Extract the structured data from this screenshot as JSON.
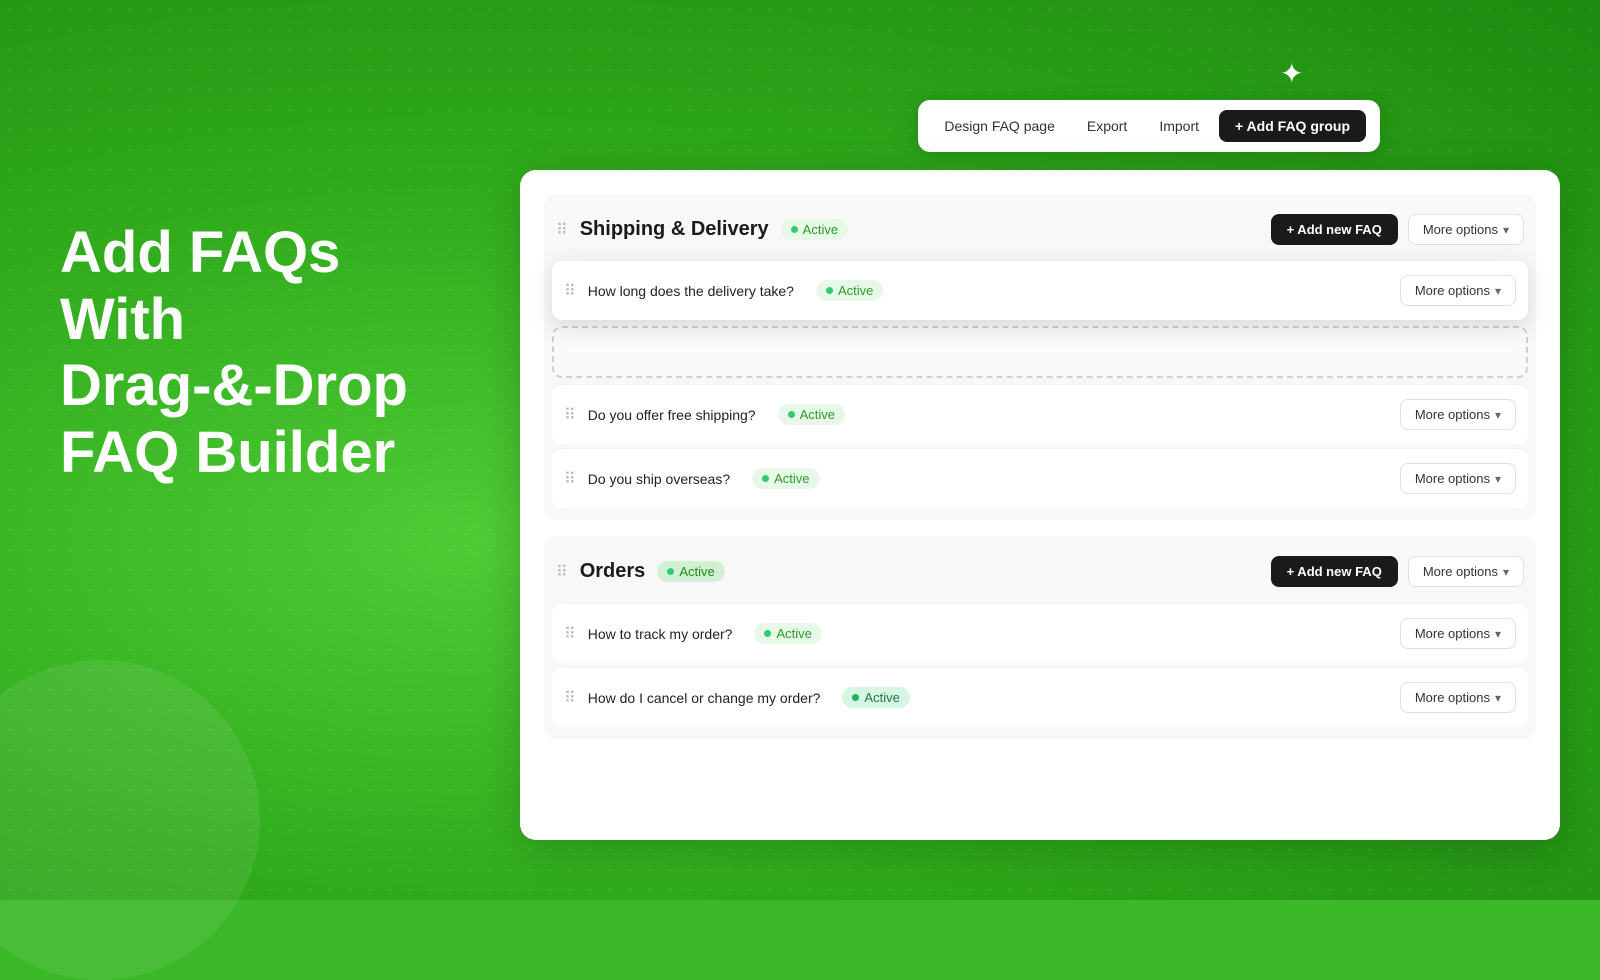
{
  "background": {
    "color": "#3ab827"
  },
  "headline": {
    "line1": "Add FAQs",
    "line2": "With",
    "line3": "Drag-&-Drop",
    "line4": "FAQ Builder"
  },
  "toolbar": {
    "design_label": "Design FAQ page",
    "export_label": "Export",
    "import_label": "Import",
    "add_group_label": "+ Add FAQ group"
  },
  "groups": [
    {
      "id": "shipping",
      "title": "Shipping & Delivery",
      "status": "Active",
      "add_faq_label": "+ Add new FAQ",
      "more_options_label": "More options",
      "items": [
        {
          "id": "delivery-time",
          "question": "How long does the delivery take?",
          "status": "Active",
          "dragging": true,
          "more_options_label": "More options"
        },
        {
          "id": "free-shipping",
          "question": "Do you offer free shipping?",
          "status": "Active",
          "more_options_label": "More options"
        },
        {
          "id": "overseas",
          "question": "Do you ship overseas?",
          "status": "Active",
          "more_options_label": "More options"
        }
      ]
    },
    {
      "id": "orders",
      "title": "Orders",
      "status": "Active",
      "add_faq_label": "+ Add new FAQ",
      "more_options_label": "More options",
      "items": [
        {
          "id": "track-order",
          "question": "How to track my order?",
          "status": "Active",
          "more_options_label": "More options"
        },
        {
          "id": "cancel-order",
          "question": "How do I cancel or change my order?",
          "status": "Active",
          "more_options_label": "More options"
        }
      ]
    }
  ],
  "icons": {
    "drag": "⠿",
    "chevron_down": "▾",
    "plus": "+"
  }
}
